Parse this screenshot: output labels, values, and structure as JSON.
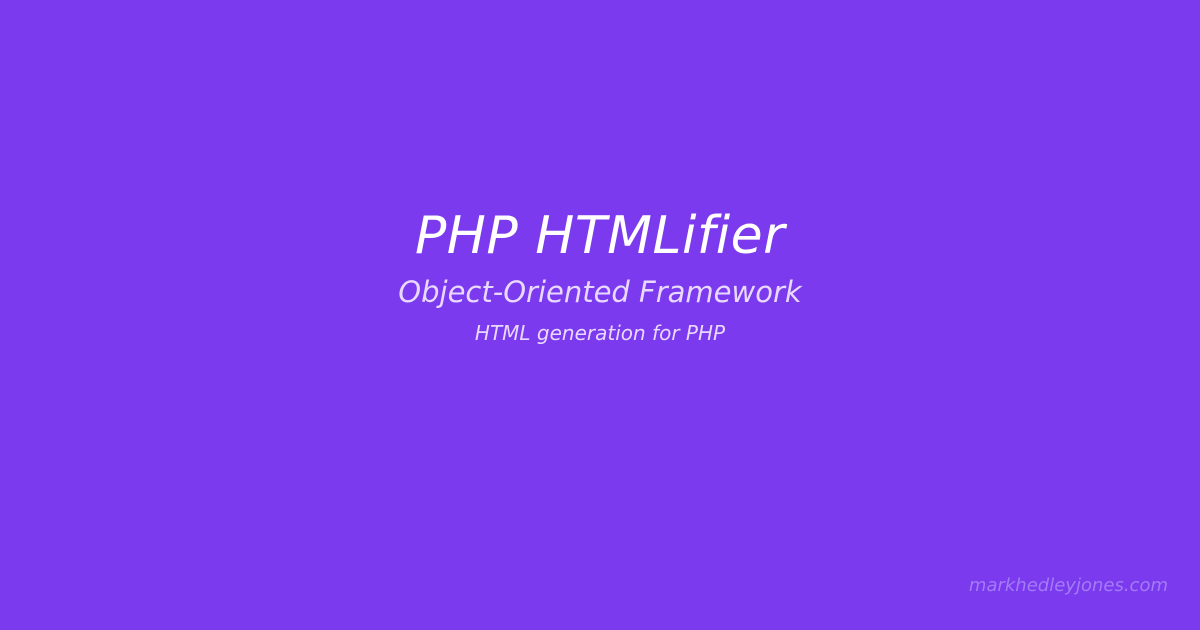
{
  "card": {
    "title": "PHP HTMLifier",
    "subtitle": "Object-Oriented Framework",
    "tagline": "HTML generation for PHP",
    "footer": "markhedleyjones.com"
  },
  "colors": {
    "background": "#7b3aed",
    "title": "#ffffff",
    "subtitle": "#e9d8ff",
    "footer": "#a47bf7"
  }
}
